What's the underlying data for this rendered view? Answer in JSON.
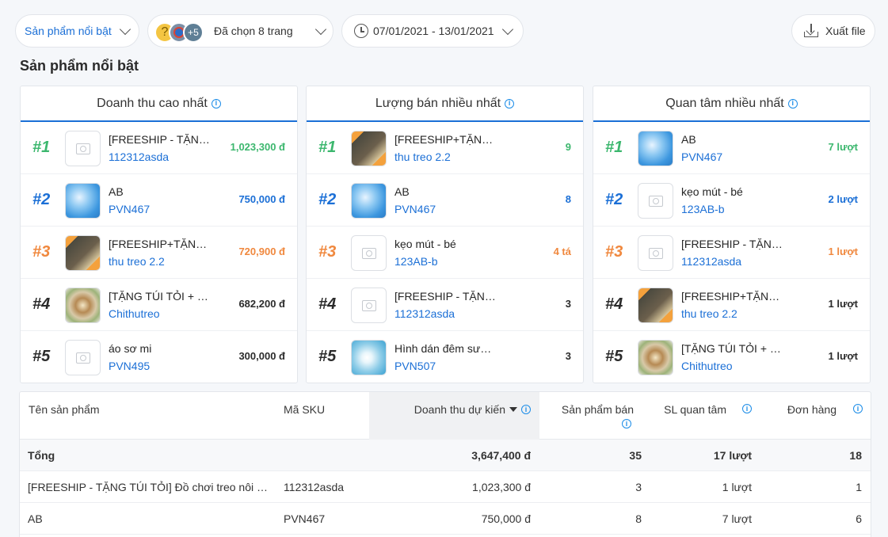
{
  "toolbar": {
    "category_label": "Sản phẩm nổi bật",
    "avatar_more": "+5",
    "pages_label": "Đã chọn 8 trang",
    "date_range": "07/01/2021 - 13/01/2021",
    "export_label": "Xuất file"
  },
  "section_title": "Sản phẩm nổi bật",
  "cards": [
    {
      "title": "Doanh thu cao nhất",
      "rows": [
        {
          "rank": "#1",
          "name": "[FREESHIP - TẶNG TÚI TỎI] Đồ chơi treo nôi",
          "sku": "112312asda",
          "value": "1,023,300 đ",
          "thumb": "placeholder"
        },
        {
          "rank": "#2",
          "name": "AB",
          "sku": "PVN467",
          "value": "750,000 đ",
          "thumb": "sky"
        },
        {
          "rank": "#3",
          "name": "[FREESHIP+TẶNG QUÀ] Thú treo nôi",
          "sku": "thu treo 2.2",
          "value": "720,900 đ",
          "thumb": "mobile"
        },
        {
          "rank": "#4",
          "name": "[TẶNG TÚI TỎI + QUÀ] Chị thú treo",
          "sku": "Chithutreo",
          "value": "682,200 đ",
          "thumb": "gift"
        },
        {
          "rank": "#5",
          "name": "áo sơ mi",
          "sku": "PVN495",
          "value": "300,000 đ",
          "thumb": "placeholder"
        }
      ]
    },
    {
      "title": "Lượng bán nhiều nhất",
      "rows": [
        {
          "rank": "#1",
          "name": "[FREESHIP+TẶNG QUÀ] Thú treo nôi",
          "sku": "thu treo 2.2",
          "value": "9",
          "thumb": "mobile"
        },
        {
          "rank": "#2",
          "name": "AB",
          "sku": "PVN467",
          "value": "8",
          "thumb": "sky"
        },
        {
          "rank": "#3",
          "name": "kẹo mút - bé",
          "sku": "123AB-b",
          "value": "4 tá",
          "thumb": "placeholder"
        },
        {
          "rank": "#4",
          "name": "[FREESHIP - TẶNG TÚI TỎI] Đồ chơi treo nôi",
          "sku": "112312asda",
          "value": "3",
          "thumb": "placeholder"
        },
        {
          "rank": "#5",
          "name": "Hình dán đêm sương mù",
          "sku": "PVN507",
          "value": "3",
          "thumb": "dandelion"
        }
      ]
    },
    {
      "title": "Quan tâm nhiều nhất",
      "rows": [
        {
          "rank": "#1",
          "name": "AB",
          "sku": "PVN467",
          "value": "7 lượt",
          "thumb": "sky"
        },
        {
          "rank": "#2",
          "name": "kẹo mút - bé",
          "sku": "123AB-b",
          "value": "2 lượt",
          "thumb": "placeholder"
        },
        {
          "rank": "#3",
          "name": "[FREESHIP - TẶNG TÚI TỎI] Đồ chơi treo nôi",
          "sku": "112312asda",
          "value": "1 lượt",
          "thumb": "placeholder"
        },
        {
          "rank": "#4",
          "name": "[FREESHIP+TẶNG QUÀ] Thú treo nôi",
          "sku": "thu treo 2.2",
          "value": "1 lượt",
          "thumb": "mobile"
        },
        {
          "rank": "#5",
          "name": "[TẶNG TÚI TỎI + QUÀ] Chị thú treo",
          "sku": "Chithutreo",
          "value": "1 lượt",
          "thumb": "gift"
        }
      ]
    }
  ],
  "table": {
    "headers": {
      "name": "Tên sản phẩm",
      "sku": "Mã SKU",
      "revenue": "Doanh thu dự kiến",
      "sold": "Sản phẩm bán",
      "interest": "SL quan tâm",
      "orders": "Đơn hàng"
    },
    "total": {
      "label": "Tổng",
      "revenue": "3,647,400 đ",
      "sold": "35",
      "interest": "17 lượt",
      "orders": "18"
    },
    "rows": [
      {
        "name": "[FREESHIP - TẶNG TÚI TỎI] Đồ chơi treo nôi cũi",
        "sku": "112312asda",
        "revenue": "1,023,300 đ",
        "sold": "3",
        "interest": "1 lượt",
        "orders": "1"
      },
      {
        "name": "AB",
        "sku": "PVN467",
        "revenue": "750,000 đ",
        "sold": "8",
        "interest": "7 lượt",
        "orders": "6"
      }
    ]
  }
}
